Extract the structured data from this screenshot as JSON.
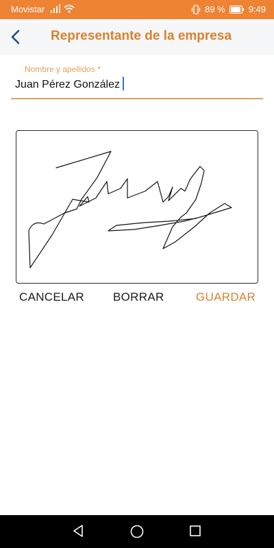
{
  "status_bar": {
    "carrier": "Movistar",
    "battery_percent": "89 %",
    "time": "9:49",
    "background_color": "#ee8333"
  },
  "header": {
    "title": "Representante de la empresa",
    "back_icon": "chevron-left-icon",
    "accent_color": "#d6822f"
  },
  "form": {
    "name_label": "Nombre y apellidos *",
    "name_value": "Juan Pérez González"
  },
  "signature": {
    "has_signature": true
  },
  "actions": {
    "cancel_label": "CANCELAR",
    "clear_label": "BORRAR",
    "save_label": "GUARDAR"
  },
  "nav_bar": {
    "back_icon": "triangle-back-icon",
    "home_icon": "circle-home-icon",
    "recents_icon": "square-recents-icon"
  }
}
